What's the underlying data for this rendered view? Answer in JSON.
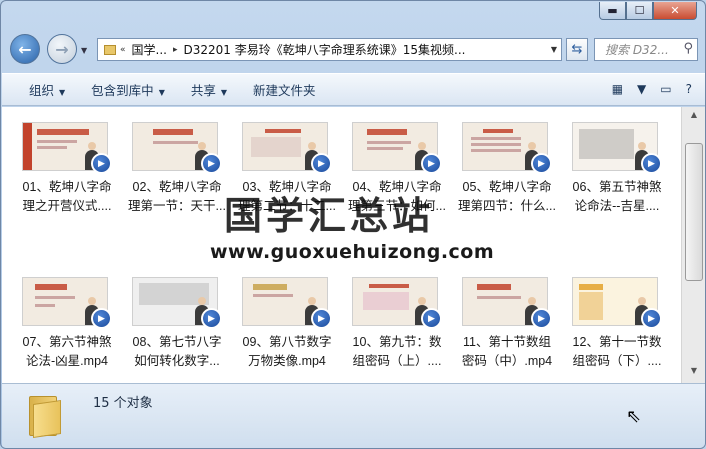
{
  "window": {
    "minimize": "▬",
    "maximize": "☐",
    "close": "✕"
  },
  "nav": {
    "back_glyph": "←",
    "forward_glyph": "→"
  },
  "address": {
    "crumbs": [
      "«",
      "国学...",
      "▸",
      "D32201 李易玲《乾坤八字命理系统课》15集视频..."
    ],
    "refresh_glyph": "⇆"
  },
  "search": {
    "placeholder": "搜索 D32..."
  },
  "toolbar": {
    "organize": "组织",
    "include_library": "包含到库中",
    "share": "共享",
    "new_folder": "新建文件夹",
    "dropdown_glyph": "▼"
  },
  "files": [
    {
      "label": "01、乾坤八字命理之开营仪式...."
    },
    {
      "label": "02、乾坤八字命理第一节：天干..."
    },
    {
      "label": "03、乾坤八字命理第二节：十二..."
    },
    {
      "label": "04、乾坤八字命理第三节：如何..."
    },
    {
      "label": "05、乾坤八字命理第四节：什么..."
    },
    {
      "label": "06、第五节神煞论命法--吉星...."
    },
    {
      "label": "07、第六节神煞论法-凶星.mp4"
    },
    {
      "label": "08、第七节八字如何转化数字..."
    },
    {
      "label": "09、第八节数字万物类像.mp4"
    },
    {
      "label": "10、第九节：数组密码（上）...."
    },
    {
      "label": "11、第十节数组密码（中）.mp4"
    },
    {
      "label": "12、第十一节数组密码（下）...."
    }
  ],
  "watermark": {
    "title": "国学汇总站",
    "url": "www.guoxuehuizong.com"
  },
  "status": {
    "count": "15 个对象"
  },
  "colors": {
    "accent": "#1e395b",
    "thumb_red": "#c2432c",
    "badge_blue": "#1b4a9a"
  }
}
